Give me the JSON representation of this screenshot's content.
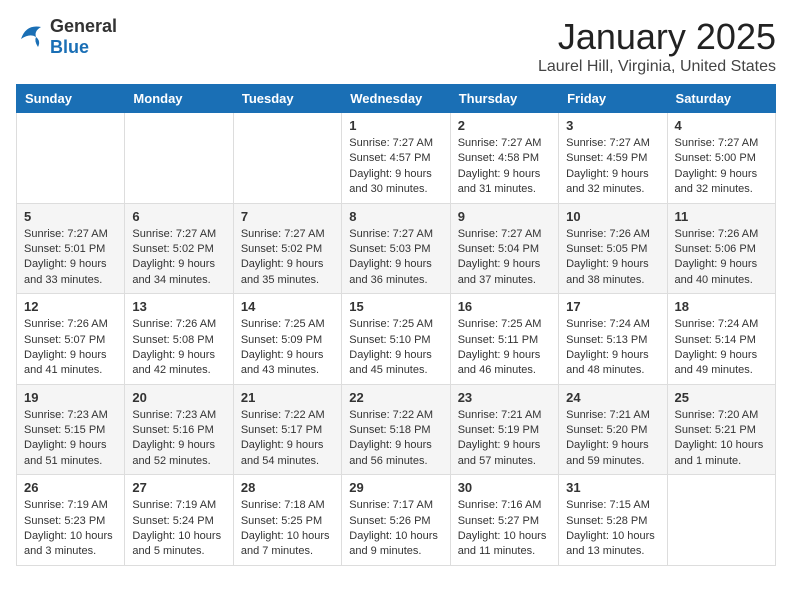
{
  "logo": {
    "general": "General",
    "blue": "Blue"
  },
  "header": {
    "title": "January 2025",
    "subtitle": "Laurel Hill, Virginia, United States"
  },
  "weekdays": [
    "Sunday",
    "Monday",
    "Tuesday",
    "Wednesday",
    "Thursday",
    "Friday",
    "Saturday"
  ],
  "weeks": [
    [
      {
        "day": "",
        "info": ""
      },
      {
        "day": "",
        "info": ""
      },
      {
        "day": "",
        "info": ""
      },
      {
        "day": "1",
        "info": "Sunrise: 7:27 AM\nSunset: 4:57 PM\nDaylight: 9 hours\nand 30 minutes."
      },
      {
        "day": "2",
        "info": "Sunrise: 7:27 AM\nSunset: 4:58 PM\nDaylight: 9 hours\nand 31 minutes."
      },
      {
        "day": "3",
        "info": "Sunrise: 7:27 AM\nSunset: 4:59 PM\nDaylight: 9 hours\nand 32 minutes."
      },
      {
        "day": "4",
        "info": "Sunrise: 7:27 AM\nSunset: 5:00 PM\nDaylight: 9 hours\nand 32 minutes."
      }
    ],
    [
      {
        "day": "5",
        "info": "Sunrise: 7:27 AM\nSunset: 5:01 PM\nDaylight: 9 hours\nand 33 minutes."
      },
      {
        "day": "6",
        "info": "Sunrise: 7:27 AM\nSunset: 5:02 PM\nDaylight: 9 hours\nand 34 minutes."
      },
      {
        "day": "7",
        "info": "Sunrise: 7:27 AM\nSunset: 5:02 PM\nDaylight: 9 hours\nand 35 minutes."
      },
      {
        "day": "8",
        "info": "Sunrise: 7:27 AM\nSunset: 5:03 PM\nDaylight: 9 hours\nand 36 minutes."
      },
      {
        "day": "9",
        "info": "Sunrise: 7:27 AM\nSunset: 5:04 PM\nDaylight: 9 hours\nand 37 minutes."
      },
      {
        "day": "10",
        "info": "Sunrise: 7:26 AM\nSunset: 5:05 PM\nDaylight: 9 hours\nand 38 minutes."
      },
      {
        "day": "11",
        "info": "Sunrise: 7:26 AM\nSunset: 5:06 PM\nDaylight: 9 hours\nand 40 minutes."
      }
    ],
    [
      {
        "day": "12",
        "info": "Sunrise: 7:26 AM\nSunset: 5:07 PM\nDaylight: 9 hours\nand 41 minutes."
      },
      {
        "day": "13",
        "info": "Sunrise: 7:26 AM\nSunset: 5:08 PM\nDaylight: 9 hours\nand 42 minutes."
      },
      {
        "day": "14",
        "info": "Sunrise: 7:25 AM\nSunset: 5:09 PM\nDaylight: 9 hours\nand 43 minutes."
      },
      {
        "day": "15",
        "info": "Sunrise: 7:25 AM\nSunset: 5:10 PM\nDaylight: 9 hours\nand 45 minutes."
      },
      {
        "day": "16",
        "info": "Sunrise: 7:25 AM\nSunset: 5:11 PM\nDaylight: 9 hours\nand 46 minutes."
      },
      {
        "day": "17",
        "info": "Sunrise: 7:24 AM\nSunset: 5:13 PM\nDaylight: 9 hours\nand 48 minutes."
      },
      {
        "day": "18",
        "info": "Sunrise: 7:24 AM\nSunset: 5:14 PM\nDaylight: 9 hours\nand 49 minutes."
      }
    ],
    [
      {
        "day": "19",
        "info": "Sunrise: 7:23 AM\nSunset: 5:15 PM\nDaylight: 9 hours\nand 51 minutes."
      },
      {
        "day": "20",
        "info": "Sunrise: 7:23 AM\nSunset: 5:16 PM\nDaylight: 9 hours\nand 52 minutes."
      },
      {
        "day": "21",
        "info": "Sunrise: 7:22 AM\nSunset: 5:17 PM\nDaylight: 9 hours\nand 54 minutes."
      },
      {
        "day": "22",
        "info": "Sunrise: 7:22 AM\nSunset: 5:18 PM\nDaylight: 9 hours\nand 56 minutes."
      },
      {
        "day": "23",
        "info": "Sunrise: 7:21 AM\nSunset: 5:19 PM\nDaylight: 9 hours\nand 57 minutes."
      },
      {
        "day": "24",
        "info": "Sunrise: 7:21 AM\nSunset: 5:20 PM\nDaylight: 9 hours\nand 59 minutes."
      },
      {
        "day": "25",
        "info": "Sunrise: 7:20 AM\nSunset: 5:21 PM\nDaylight: 10 hours\nand 1 minute."
      }
    ],
    [
      {
        "day": "26",
        "info": "Sunrise: 7:19 AM\nSunset: 5:23 PM\nDaylight: 10 hours\nand 3 minutes."
      },
      {
        "day": "27",
        "info": "Sunrise: 7:19 AM\nSunset: 5:24 PM\nDaylight: 10 hours\nand 5 minutes."
      },
      {
        "day": "28",
        "info": "Sunrise: 7:18 AM\nSunset: 5:25 PM\nDaylight: 10 hours\nand 7 minutes."
      },
      {
        "day": "29",
        "info": "Sunrise: 7:17 AM\nSunset: 5:26 PM\nDaylight: 10 hours\nand 9 minutes."
      },
      {
        "day": "30",
        "info": "Sunrise: 7:16 AM\nSunset: 5:27 PM\nDaylight: 10 hours\nand 11 minutes."
      },
      {
        "day": "31",
        "info": "Sunrise: 7:15 AM\nSunset: 5:28 PM\nDaylight: 10 hours\nand 13 minutes."
      },
      {
        "day": "",
        "info": ""
      }
    ]
  ]
}
